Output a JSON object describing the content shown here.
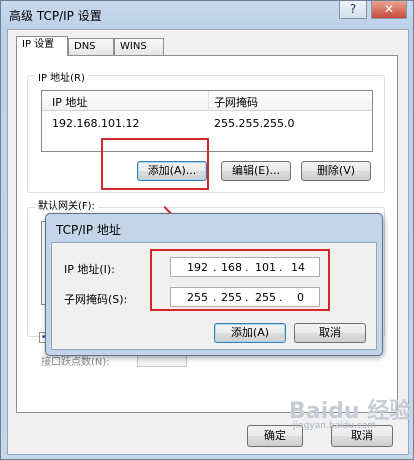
{
  "window": {
    "title": "高级 TCP/IP 设置",
    "help_btn": "?",
    "close_btn": "✕"
  },
  "tabs": [
    {
      "label": "IP 设置"
    },
    {
      "label": "DNS"
    },
    {
      "label": "WINS"
    }
  ],
  "ip_group": {
    "label": "IP 地址(R)",
    "columns": [
      "IP 地址",
      "子网掩码"
    ],
    "rows": [
      {
        "ip": "192.168.101.12",
        "mask": "255.255.255.0"
      }
    ]
  },
  "ip_buttons": {
    "add": "添加(A)...",
    "edit": "编辑(E)...",
    "delete": "删除(V)"
  },
  "gateway_group": {
    "label": "默认网关(F):"
  },
  "bottom_fragment": {
    "text": "接口跃点数(N):"
  },
  "dialog": {
    "title": "TCP/IP 地址",
    "ip_label": "IP 地址(I):",
    "ip_octets": [
      "192",
      "168",
      "101",
      "14"
    ],
    "mask_label": "子网掩码(S):",
    "mask_octets": [
      "255",
      "255",
      "255",
      "0"
    ],
    "add_btn": "添加(A)",
    "cancel_btn": "取消"
  },
  "footer": {
    "ok": "确定",
    "cancel": "取消"
  },
  "watermark": {
    "text": "Baidu 经验",
    "sub": "jingyan.baidu.com"
  },
  "colors": {
    "highlight": "#d3272a"
  }
}
